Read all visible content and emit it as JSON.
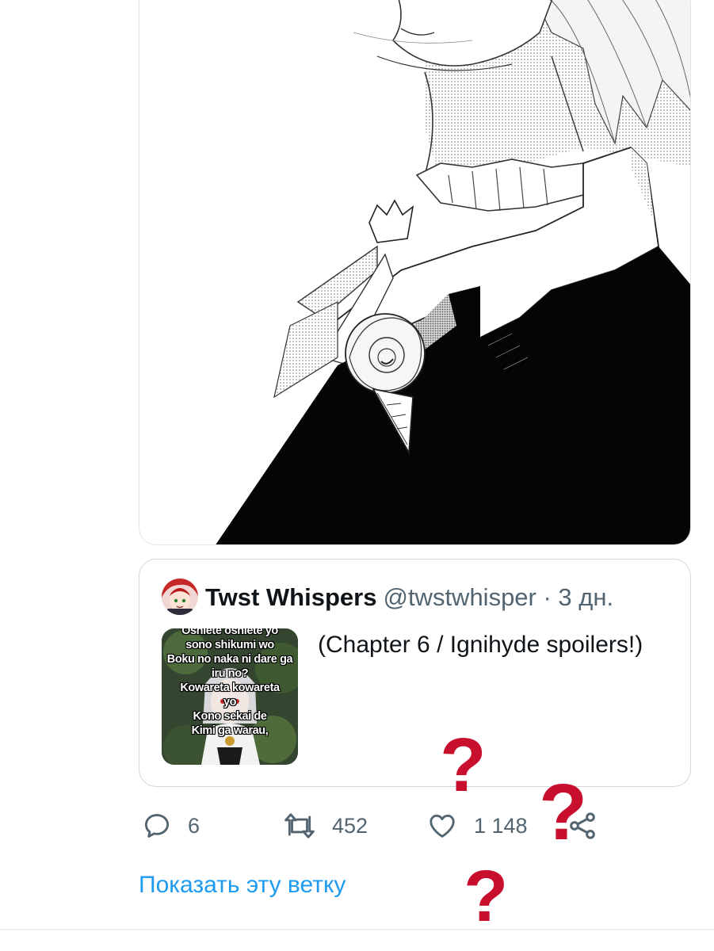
{
  "quote": {
    "author_name": "Twst Whispers",
    "author_meta": "@twstwhisper · 3 дн.",
    "text": "(Chapter 6 / Ignihyde spoilers!)",
    "thumbnail_lines": [
      "Oshiete oshiete yo",
      "sono shikumi wo",
      "Boku no naka ni dare ga",
      "iru no?",
      "Kowareta kowareta",
      "yo",
      "Kono sekai de",
      "Kimi ga warau,"
    ]
  },
  "actions": {
    "reply_icon": "reply-icon",
    "reply_count": "6",
    "retweet_icon": "retweet-icon",
    "retweet_count": "452",
    "like_icon": "heart-icon",
    "like_count": "1 148",
    "share_icon": "share-icon"
  },
  "show_thread_label": "Показать эту ветку",
  "overlay": {
    "symbol": "?",
    "color": "#c8102e"
  },
  "colors": {
    "link": "#1d9bf0",
    "muted": "#536471",
    "border": "#cfd9de"
  }
}
